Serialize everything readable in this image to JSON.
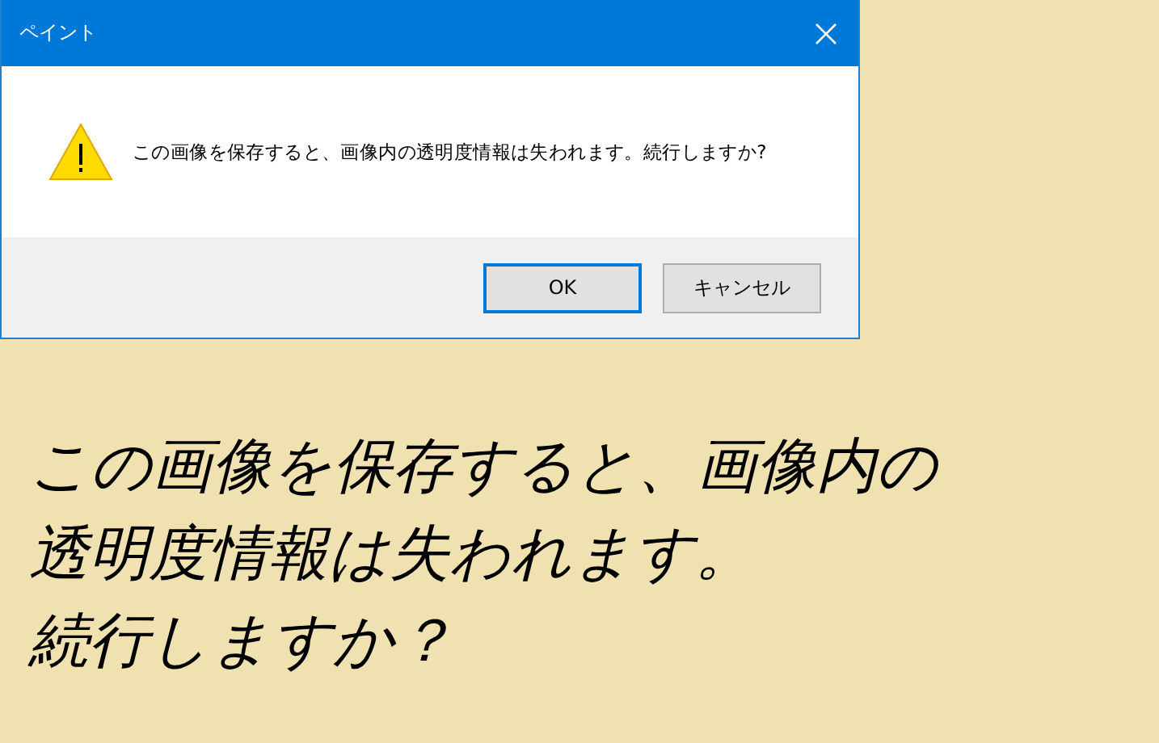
{
  "window": {
    "title": "ペイント"
  },
  "message": "この画像を保存すると、画像内の透明度情報は失われます。続行しますか?",
  "buttons": [
    {
      "label": "OK",
      "selected": true
    },
    {
      "label": "キャンセル",
      "selected": false
    }
  ],
  "caption": [
    "この画像を保存すると、画像内の",
    "透明度情報は失われます。",
    "続行しますか？"
  ]
}
